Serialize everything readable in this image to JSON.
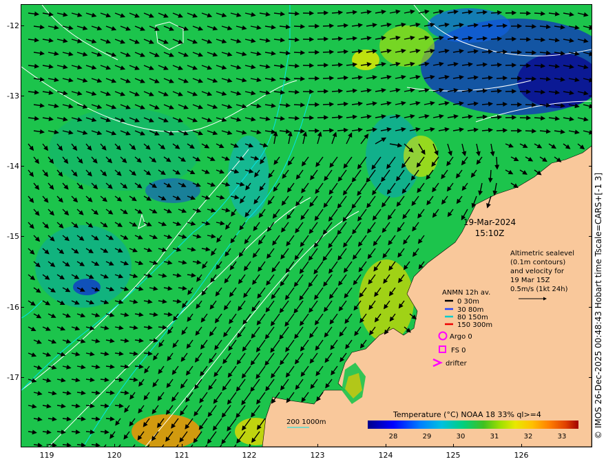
{
  "map": {
    "lat_labels": [
      "-12",
      "-13",
      "-14",
      "-15",
      "-16",
      "-17"
    ],
    "lon_labels": [
      "119",
      "120",
      "121",
      "122",
      "123",
      "124",
      "125",
      "126"
    ]
  },
  "datetime": {
    "date": "19-Mar-2024",
    "time": "15:10Z"
  },
  "altimetry_note": [
    "Altimetric sealevel",
    "(0.1m contours)",
    "and velocity for",
    "19 Mar 15Z",
    "0.5m/s (1kt 24h)"
  ],
  "legend": {
    "title": "ANMN 12h av.",
    "depths": [
      {
        "label": "0 30m",
        "color": "#000000"
      },
      {
        "label": "30 80m",
        "color": "#2244ff"
      },
      {
        "label": "80 150m",
        "color": "#00cccc"
      },
      {
        "label": "150 300m",
        "color": "#ee0000"
      }
    ],
    "argo": "Argo 0",
    "fs": "FS 0",
    "drifter": "drifter",
    "symbol_color": "#ff00ff"
  },
  "bathy_label": "200  1000m",
  "colorbar": {
    "title": "Temperature (°C) NOAA 18 33% ql>=4",
    "ticks": [
      "28",
      "29",
      "30",
      "31",
      "32",
      "33"
    ],
    "colors": [
      "#00008b",
      "#0000ff",
      "#0080ff",
      "#00c0ff",
      "#00e0a0",
      "#20c020",
      "#80e000",
      "#e0e000",
      "#ffc000",
      "#ff8000",
      "#e04000",
      "#a00000"
    ]
  },
  "credit": "© IMOS 26-Dec-2025 00:48:43 Hobart time Tscale=CARS+[-1 3]",
  "colors": {
    "land": "#f9c89b",
    "sst_mid": "#1cc44c",
    "current": "#000000",
    "contour": "#ffffff",
    "bathy": "#00e5ee"
  }
}
